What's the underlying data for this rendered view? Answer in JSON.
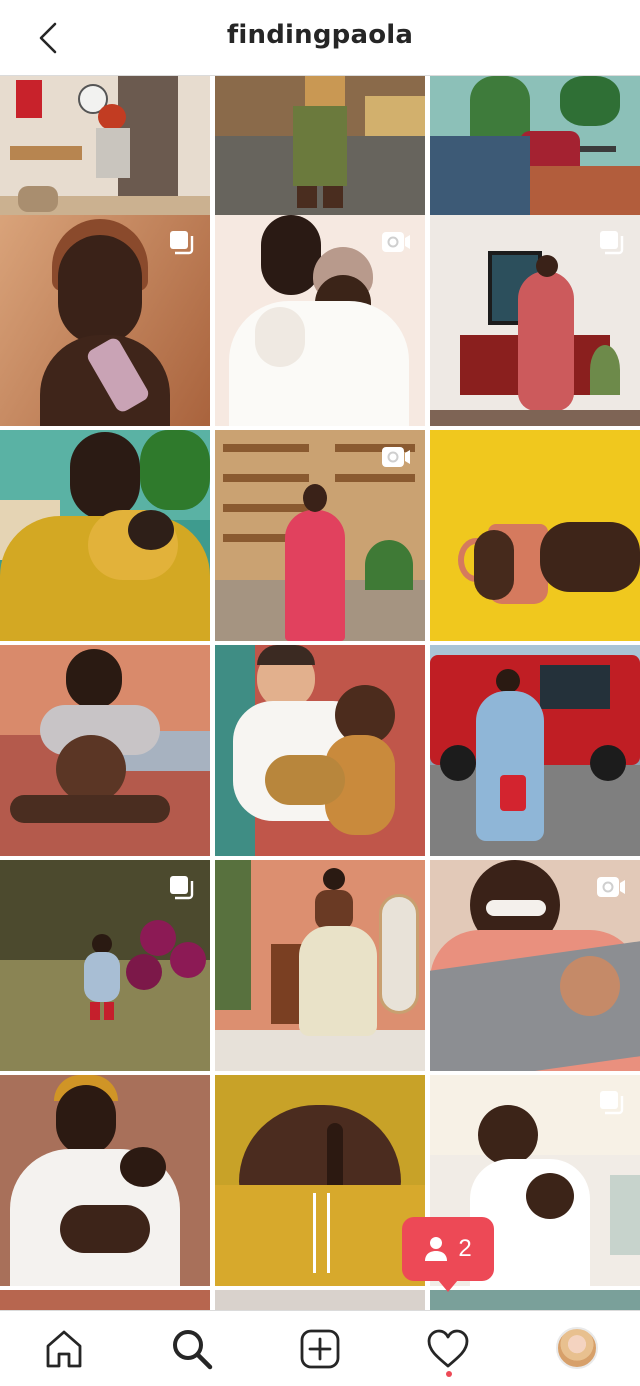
{
  "header": {
    "title": "findingpaola"
  },
  "colors": {
    "accent": "#ed4956",
    "border": "#dbdbdb",
    "text": "#262626"
  },
  "grid": {
    "posts": [
      {
        "name": "post-kitchen-table-child",
        "badge": "none"
      },
      {
        "name": "post-standing-sunlight",
        "badge": "none"
      },
      {
        "name": "post-living-room-plants",
        "badge": "none"
      },
      {
        "name": "post-woman-holding-bottle",
        "badge": "multiple"
      },
      {
        "name": "post-mother-child-portrait",
        "badge": "video"
      },
      {
        "name": "post-woman-pink-dress",
        "badge": "multiple"
      },
      {
        "name": "post-mother-baby-yellow",
        "badge": "none"
      },
      {
        "name": "post-bookshelf-nursing",
        "badge": "video"
      },
      {
        "name": "post-pink-mug",
        "badge": "none"
      },
      {
        "name": "post-pregnant-bed",
        "badge": "none"
      },
      {
        "name": "post-father-children",
        "badge": "none"
      },
      {
        "name": "post-red-truck",
        "badge": "none"
      },
      {
        "name": "post-child-balloons",
        "badge": "multiple"
      },
      {
        "name": "post-woman-white-skirt",
        "badge": "none"
      },
      {
        "name": "post-baby-wrap",
        "badge": "video"
      },
      {
        "name": "post-white-shirt-nursing",
        "badge": "none"
      },
      {
        "name": "post-belly-closeup",
        "badge": "none"
      },
      {
        "name": "post-child-with-baby",
        "badge": "multiple"
      }
    ]
  },
  "notification": {
    "icon": "person-icon",
    "count": "2"
  },
  "nav": {
    "items": [
      {
        "name": "home",
        "icon": "home-icon"
      },
      {
        "name": "search",
        "icon": "search-icon"
      },
      {
        "name": "create",
        "icon": "plus-square-icon"
      },
      {
        "name": "activity",
        "icon": "heart-icon"
      },
      {
        "name": "profile",
        "icon": "avatar"
      }
    ]
  }
}
